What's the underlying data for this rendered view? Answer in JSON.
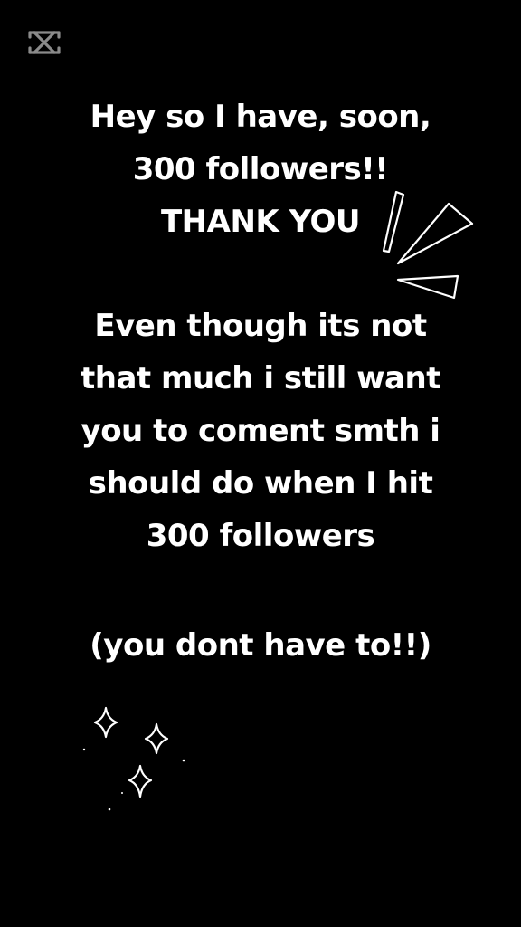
{
  "app_logo_icon": "capcut-logo-icon",
  "message": {
    "block1": [
      "Hey so I have, soon,",
      "300 followers!!",
      "THANK YOU"
    ],
    "block2": [
      "Even though its not",
      "that much i still want",
      "you to coment smth i",
      "should do when I hit",
      "300 followers"
    ],
    "block3": [
      "(you dont have to!!)"
    ]
  },
  "colors": {
    "background": "#000000",
    "text": "#ffffff",
    "logo": "#8a8a8a"
  }
}
